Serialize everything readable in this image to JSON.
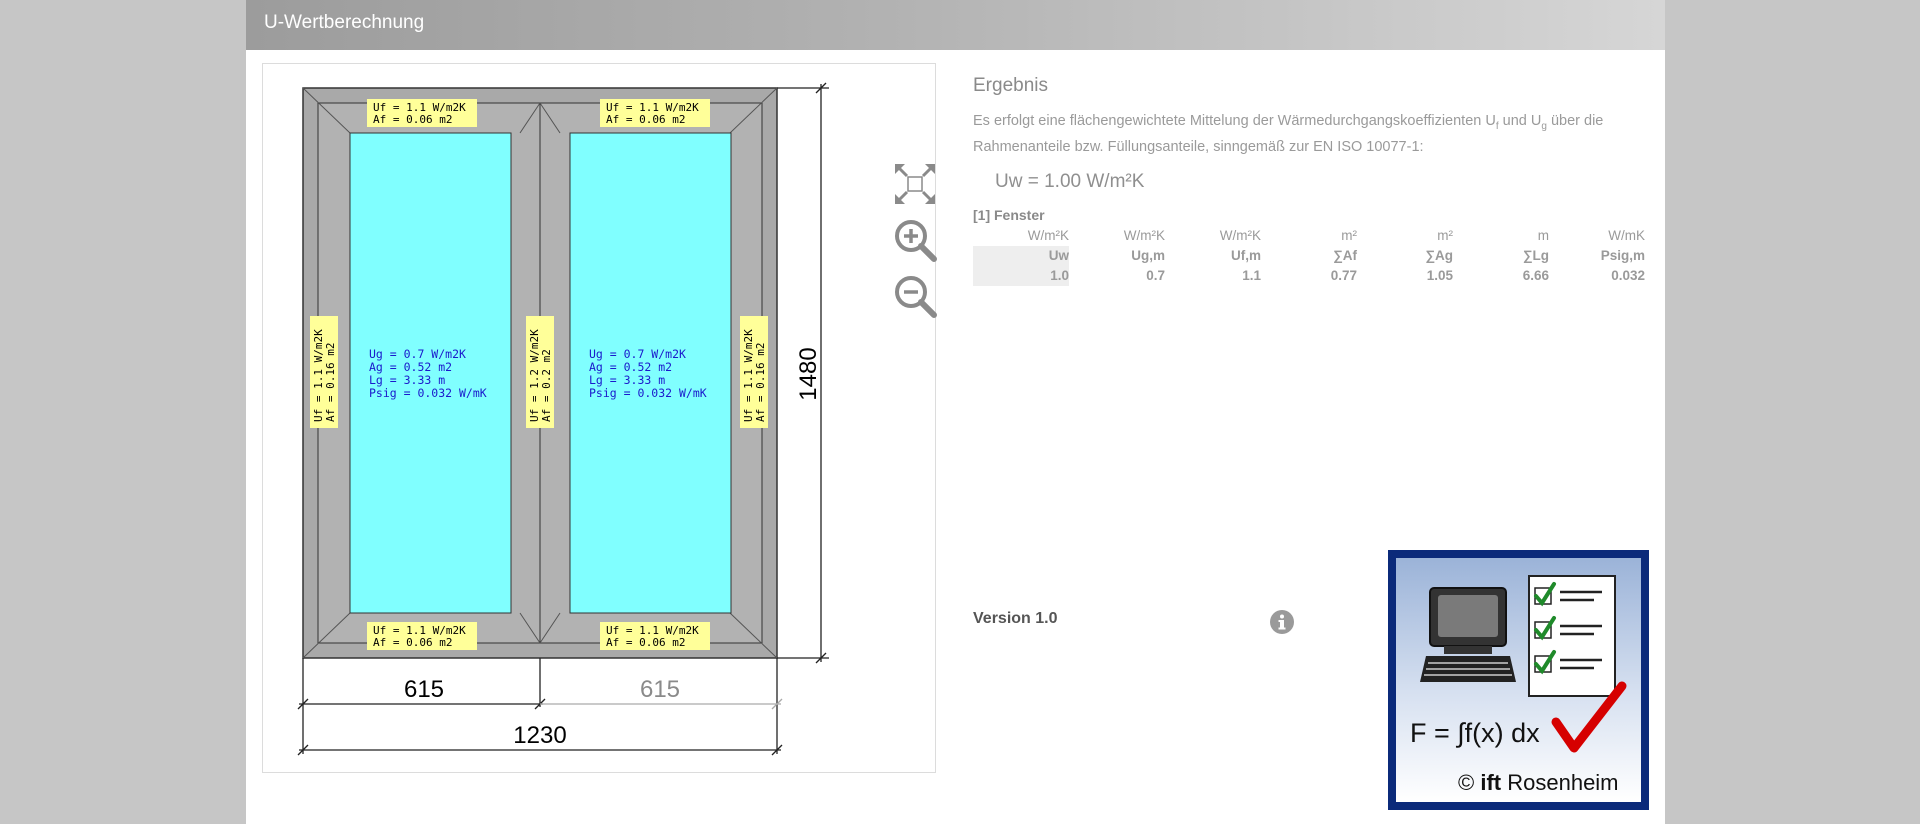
{
  "app": {
    "title": "U-Wertberechnung"
  },
  "drawing": {
    "frame_labels": {
      "top_left": {
        "uf": "Uf  =  1.1  W/m2K",
        "af": "Af  =  0.06  m2"
      },
      "top_right": {
        "uf": "Uf  =  1.1  W/m2K",
        "af": "Af  =  0.06  m2"
      },
      "bottom_left": {
        "uf": "Uf  =  1.1  W/m2K",
        "af": "Af  =  0.06  m2"
      },
      "bottom_right": {
        "uf": "Uf  =  1.1  W/m2K",
        "af": "Af  =  0.06  m2"
      },
      "left": {
        "uf": "Uf  =  1.1  W/m2K",
        "af": "Af  =  0.16  m2"
      },
      "mullion": {
        "uf": "Uf  =  1.2  W/m2K",
        "af": "Af  =  0.2  m2"
      },
      "right": {
        "uf": "Uf  =  1.1  W/m2K",
        "af": "Af  =  0.16  m2"
      }
    },
    "glass_left": {
      "ug": "Ug  =  0.7  W/m2K",
      "ag": "Ag  =  0.52  m2",
      "lg": "Lg  =  3.33  m",
      "psig": "Psig  =  0.032  W/mK"
    },
    "glass_right": {
      "ug": "Ug  =  0.7  W/m2K",
      "ag": "Ag  =  0.52  m2",
      "lg": "Lg  =  3.33  m",
      "psig": "Psig  =  0.032  W/mK"
    },
    "dimensions": {
      "height": "1480",
      "width_left": "615",
      "width_right": "615",
      "total_width": "1230"
    }
  },
  "tools": {
    "fit_icon": "fit-screen-icon",
    "zoom_in_icon": "zoom-in-icon",
    "zoom_out_icon": "zoom-out-icon"
  },
  "result": {
    "title": "Ergebnis",
    "desc_part1": "Es erfolgt eine flächengewichtete Mittelung der Wärmedurchgangskoeffizienten U",
    "desc_sub1": "f",
    "desc_part2": " und U",
    "desc_sub2": "g",
    "desc_part3": " über die Rahmenanteile bzw. Füllungsanteile, sinngemäß zur EN ISO 10077-1:",
    "uw": "Uw = 1.00 W/m²K",
    "section": "[1] Fenster",
    "table": {
      "units": [
        "W/m²K",
        "W/m²K",
        "W/m²K",
        "m²",
        "m²",
        "m",
        "W/mK"
      ],
      "headers": [
        "Uw",
        "Ug,m",
        "Uf,m",
        "∑Af",
        "∑Ag",
        "∑Lg",
        "Psig,m"
      ],
      "values": [
        "1.0",
        "0.7",
        "1.1",
        "0.77",
        "1.05",
        "6.66",
        "0.032"
      ]
    }
  },
  "footer": {
    "version": "Version 1.0",
    "info_icon": "info-icon"
  },
  "logo": {
    "formula": "F = ∫f(x) dx",
    "copyright_symbol": "©",
    "brand": "ift",
    "place": "Rosenheim"
  },
  "colors": {
    "glass": "#80ffff",
    "frame": "#a9a9a9",
    "label_bg": "#ffff99",
    "glass_text": "#1a1acc",
    "logo_border": "#0b2a7a"
  }
}
